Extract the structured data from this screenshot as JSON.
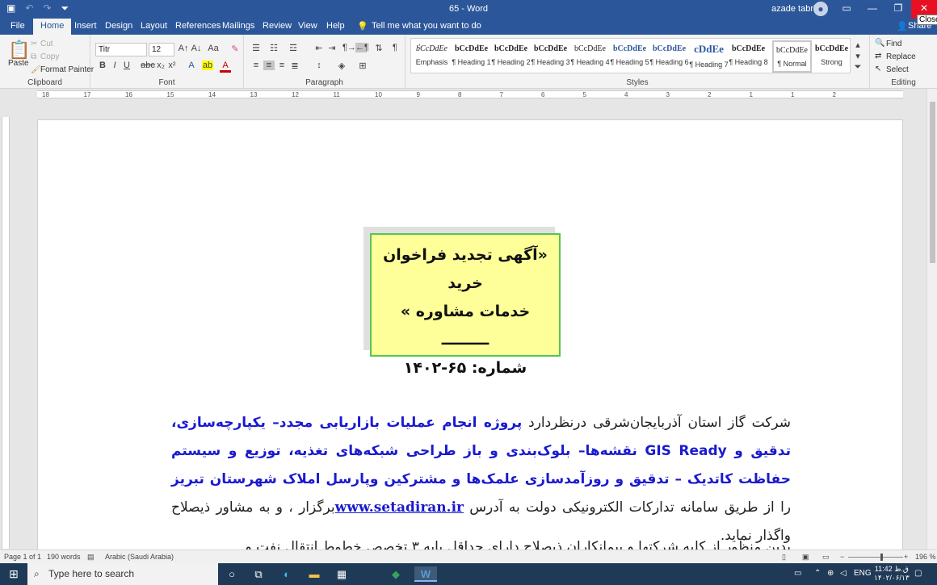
{
  "app": {
    "title": "65  -  Word",
    "user": "azade tabrizi",
    "close_tooltip": "Close"
  },
  "qat": {
    "save_icon": "save-icon",
    "undo_icon": "undo-icon",
    "redo_icon": "redo-icon",
    "customize_icon": "customize-qat-icon"
  },
  "tabs": [
    {
      "label": "File"
    },
    {
      "label": "Home"
    },
    {
      "label": "Insert"
    },
    {
      "label": "Design"
    },
    {
      "label": "Layout"
    },
    {
      "label": "References"
    },
    {
      "label": "Mailings"
    },
    {
      "label": "Review"
    },
    {
      "label": "View"
    },
    {
      "label": "Help"
    }
  ],
  "tell_me": "Tell me what you want to do",
  "share": "Share",
  "clipboard": {
    "paste": "Paste",
    "cut": "Cut",
    "copy": "Copy",
    "format_painter": "Format Painter",
    "label": "Clipboard"
  },
  "font": {
    "name": "Titr",
    "size": "12",
    "label": "Font",
    "buttons": {
      "bold": "B",
      "italic": "I",
      "underline": "U",
      "strike": "abc",
      "sub": "x₂",
      "sup": "x²"
    }
  },
  "paragraph": {
    "label": "Paragraph"
  },
  "styles": {
    "label": "Styles",
    "items": [
      {
        "preview": "ٰbCcDdEe",
        "name": "Emphasis"
      },
      {
        "preview": "bCcDdEe",
        "name": "¶ Heading 1"
      },
      {
        "preview": "bCcDdEe",
        "name": "¶ Heading 2"
      },
      {
        "preview": "bCcDdEe",
        "name": "¶ Heading 3"
      },
      {
        "preview": "bCcDdEe",
        "name": "¶ Heading 4"
      },
      {
        "preview": "bCcDdEe",
        "name": "¶ Heading 5"
      },
      {
        "preview": "bCcDdEe",
        "name": "¶ Heading 6"
      },
      {
        "preview": "cDdEe",
        "name": "¶ Heading 7"
      },
      {
        "preview": "bCcDdEe",
        "name": "¶ Heading 8"
      },
      {
        "preview": "bCcDdEe",
        "name": "¶ Normal"
      },
      {
        "preview": "bCcDdEe",
        "name": "Strong"
      }
    ]
  },
  "editing": {
    "find": "Find",
    "replace": "Replace",
    "select": "Select",
    "label": "Editing"
  },
  "ruler": {
    "numbers": [
      "18",
      "17",
      "16",
      "15",
      "14",
      "13",
      "12",
      "11",
      "10",
      "9",
      "8",
      "7",
      "6",
      "5",
      "4",
      "3",
      "2",
      "1",
      "1",
      "2"
    ]
  },
  "document": {
    "notice_line1": "«آگهی تجدید فراخوان خرید",
    "notice_line2": "خدمات مشاوره »",
    "notice_line3": "ـــــــــ",
    "notice_line4": "شماره:   ۶۵-۱۴۰۲",
    "p1_a": "شرکت گاز استان آذربایجان‌شرقی درنظردارد ",
    "p1_b": "پروژه  انجام عملیات بازاریابی مجدد– یکپارچه‌سازی، تدقیق و  GIS Ready نقشه‌ها– بلوک‌بندی و باز طراحی  شبکه‌های تغذیه،  توزیع و سیستم حفاظت کاتدیک – تدقیق و روزآمدسازی علمک‌ها و مشترکین وپارسل املاک شهرستان تبریز",
    "p1_c": " را از طریق سامانه تدارکات الکترونیکی دولت به آدرس ",
    "p1_link": "www.setadiran.ir",
    "p1_d": "برگزار ، و به مشاور ذیصلاح واگذار نماید.",
    "p2": "بدین منظور از کلیه شرکتها و پیمانکاران ذیصلاح دارای حداقل پایه ۳ تخصص خطوط انتقال نفت و"
  },
  "status": {
    "page": "Page 1 of 1",
    "words": "190 words",
    "language": "Arabic (Saudi Arabia)",
    "zoom": "196 %"
  },
  "taskbar": {
    "search_placeholder": "Type here to search",
    "lang": "ENG",
    "time": "11:42 ق.ظ",
    "date": "۱۴۰۲/۰۶/۱۳"
  }
}
